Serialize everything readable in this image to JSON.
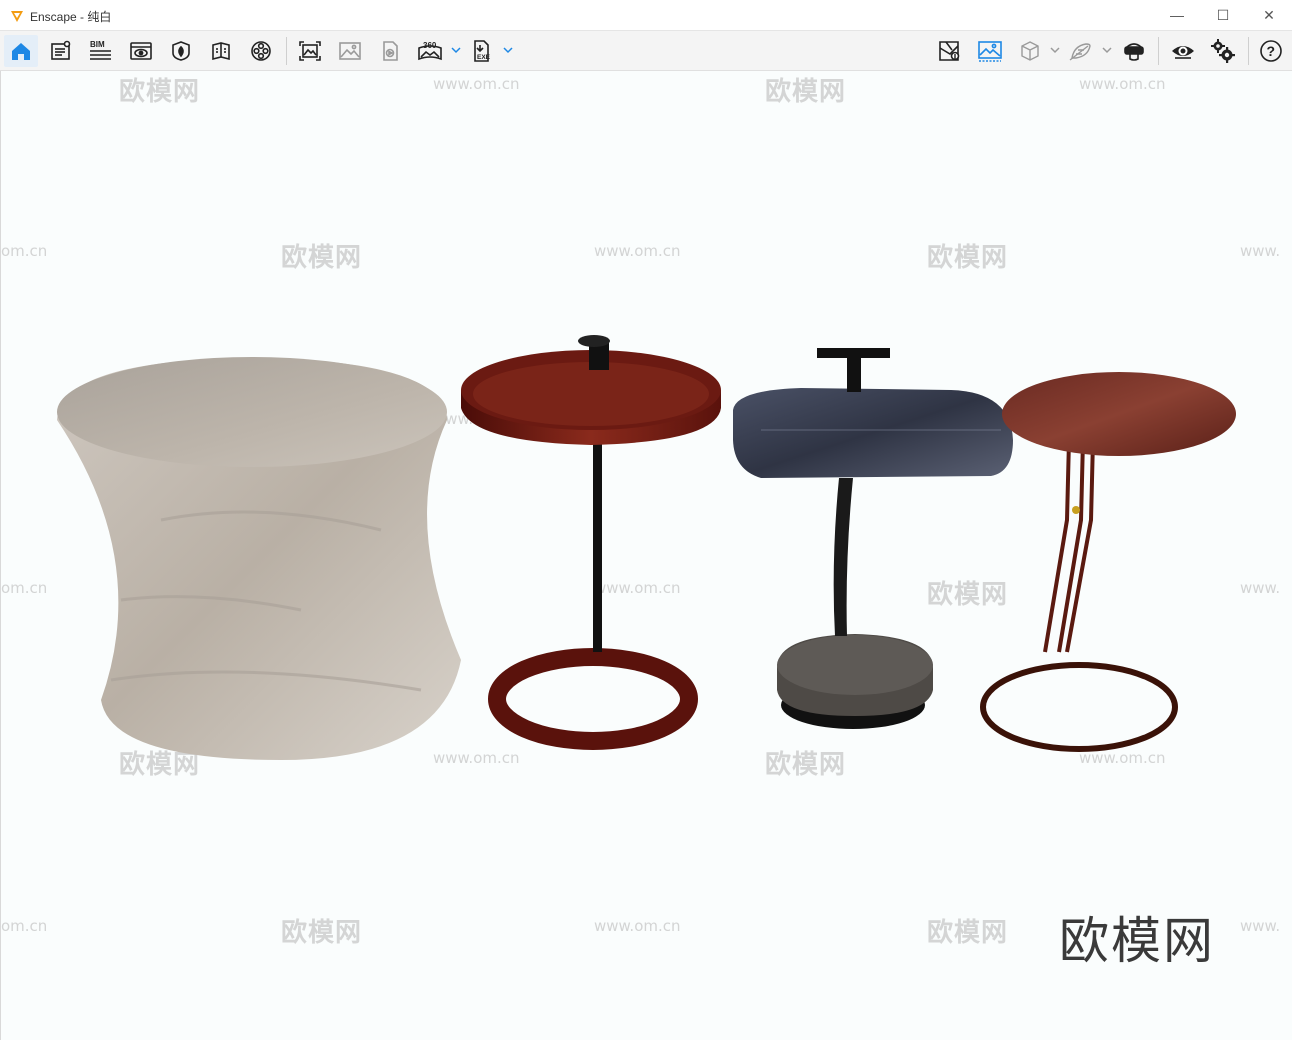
{
  "window": {
    "title": "Enscape - 纯白",
    "controls": [
      "—",
      "☐",
      "✕"
    ]
  },
  "toolbar": {
    "left_icons": [
      "home-icon",
      "project-notes-icon",
      "bim-icon",
      "view-management-icon",
      "asset-library-icon",
      "material-editor-icon",
      "atmosphere-icon",
      "screenshot-icon",
      "batch-render-icon",
      "video-render-icon",
      "panorama-360-icon",
      "export-exe-icon"
    ],
    "bim_label": "BIM",
    "pano_label": "360",
    "exe_label": "EXE",
    "right_icons": [
      "sync-views-icon",
      "capture-image-icon",
      "visual-settings-cube-icon",
      "orthographic-icon",
      "vr-headset-icon",
      "show-hide-icon",
      "settings-icon",
      "help-icon"
    ],
    "help_label": "?"
  },
  "watermark": {
    "cn": "欧模网",
    "url": "www.om.cn",
    "url_partial": "om.cn",
    "url_cut": "www."
  },
  "brand_logo_text": "欧模网",
  "colors": {
    "accent": "#1e88e5",
    "viewport_bg": "#fafdfd",
    "toolbar_bg": "#f4f4f4"
  }
}
